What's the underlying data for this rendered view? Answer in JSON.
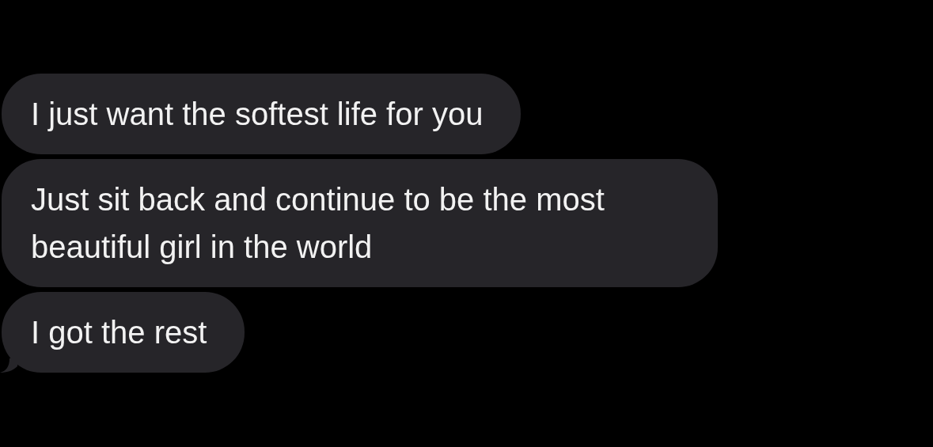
{
  "messages": [
    {
      "text": "I just want the softest life for you",
      "tail": false
    },
    {
      "text": "Just sit back and continue to be the most beautiful girl in the world",
      "tail": false
    },
    {
      "text": "I got the rest",
      "tail": true
    }
  ]
}
